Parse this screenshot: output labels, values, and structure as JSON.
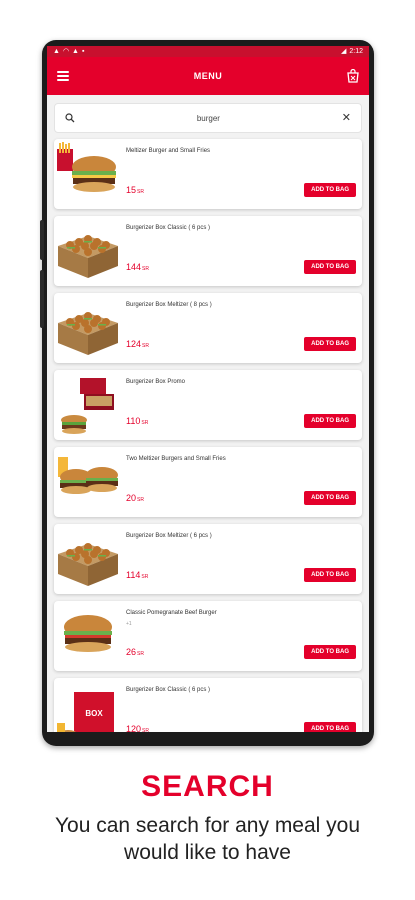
{
  "status": {
    "time": "2:12"
  },
  "appbar": {
    "title": "MENU"
  },
  "search": {
    "value": "burger"
  },
  "products": [
    {
      "name": "Meltizer Burger and Small Fries",
      "sub": "",
      "price": "15",
      "currency": "SR",
      "button": "ADD TO BAG",
      "image": "burger-fries"
    },
    {
      "name": "Burgerizer Box Classic ( 6 pcs )",
      "sub": "",
      "price": "144",
      "currency": "SR",
      "button": "ADD TO BAG",
      "image": "box-sliders"
    },
    {
      "name": "Burgerizer Box Meltizer ( 8 pcs )",
      "sub": "",
      "price": "124",
      "currency": "SR",
      "button": "ADD TO BAG",
      "image": "box-sliders"
    },
    {
      "name": "Burgerizer Box Promo",
      "sub": "",
      "price": "110",
      "currency": "SR",
      "button": "ADD TO BAG",
      "image": "promo-box"
    },
    {
      "name": "Two Meltizer Burgers and Small Fries",
      "sub": "",
      "price": "20",
      "currency": "SR",
      "button": "ADD TO BAG",
      "image": "two-burgers"
    },
    {
      "name": "Burgerizer Box Meltizer ( 6 pcs )",
      "sub": "",
      "price": "114",
      "currency": "SR",
      "button": "ADD TO BAG",
      "image": "box-sliders"
    },
    {
      "name": "Classic Pomegranate Beef Burger",
      "sub": "+1",
      "price": "26",
      "currency": "SR",
      "button": "ADD TO BAG",
      "image": "single-burger"
    },
    {
      "name": "Burgerizer Box Classic ( 6 pcs )",
      "sub": "",
      "price": "120",
      "currency": "SR",
      "button": "ADD TO BAG",
      "image": "red-box"
    }
  ],
  "caption": {
    "title": "SEARCH",
    "subtitle": "You can search for any meal you would like to have"
  },
  "colors": {
    "brand": "#e4002b",
    "status_bar": "#c8102e"
  },
  "icons": {
    "menu": "hamburger-icon",
    "bag": "bag-icon",
    "search": "search-icon",
    "clear": "close-icon"
  }
}
